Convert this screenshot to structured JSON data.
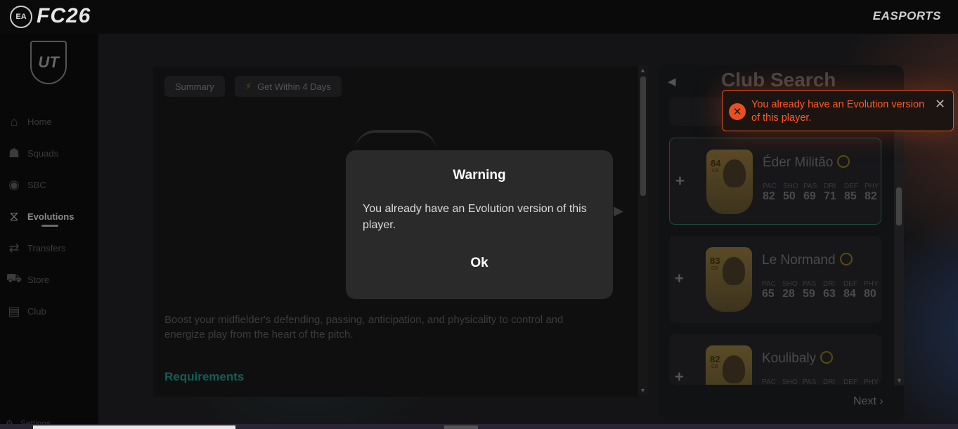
{
  "app": {
    "ea_logo_text": "EA",
    "title": "FC26",
    "brand": "EASPORTS"
  },
  "sidebar": {
    "badge": "UT",
    "items": [
      {
        "label": "Home",
        "icon": "home-icon"
      },
      {
        "label": "Squads",
        "icon": "squads-icon"
      },
      {
        "label": "SBC",
        "icon": "sbc-icon"
      },
      {
        "label": "Evolutions",
        "icon": "evolutions-icon",
        "active": true
      },
      {
        "label": "Transfers",
        "icon": "transfers-icon"
      },
      {
        "label": "Store",
        "icon": "store-icon"
      },
      {
        "label": "Club",
        "icon": "club-icon"
      }
    ],
    "settings_label": "Settings"
  },
  "main": {
    "chips": [
      {
        "label": "Summary"
      },
      {
        "label": "Get Within 4 Days"
      }
    ],
    "description": "Boost your midfielder's defending, passing, anticipation, and physicality to control and energize play from the heart of the pitch.",
    "requirements_heading": "Requirements"
  },
  "club_search": {
    "title": "Club Search",
    "next_label": "Next",
    "stat_keys": [
      "PAC",
      "SHO",
      "PAS",
      "DRI",
      "DEF",
      "PHY"
    ],
    "players": [
      {
        "name": "Éder Militão",
        "rating": "84",
        "position": "CB",
        "stats": [
          "82",
          "50",
          "69",
          "71",
          "85",
          "82"
        ]
      },
      {
        "name": "Le Normand",
        "rating": "83",
        "position": "CB",
        "stats": [
          "65",
          "28",
          "59",
          "63",
          "84",
          "80"
        ]
      },
      {
        "name": "Koulibaly",
        "rating": "82",
        "position": "CB",
        "stats": [
          "",
          "",
          "",
          "",
          "",
          ""
        ]
      }
    ]
  },
  "modal": {
    "title": "Warning",
    "message": "You already have an Evolution version of this player.",
    "ok_label": "Ok"
  },
  "toast": {
    "message": "You already have an Evolution version of this player.",
    "close_glyph": "✕",
    "color": "#ff5a26"
  }
}
